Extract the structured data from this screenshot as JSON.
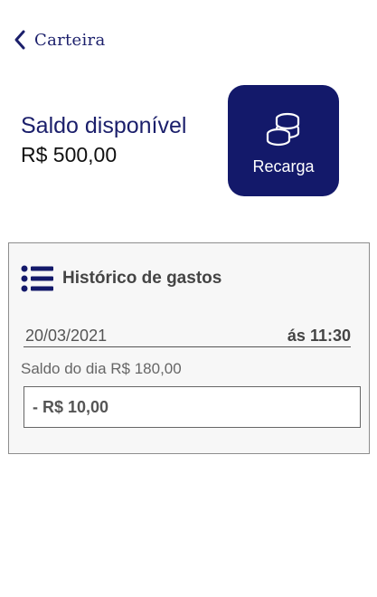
{
  "header": {
    "title": "Carteira",
    "back_icon": "chevron-left-icon"
  },
  "balance": {
    "label": "Saldo disponível",
    "value": "R$ 500,00"
  },
  "recharge": {
    "label": "Recarga",
    "icon": "coins-icon"
  },
  "history": {
    "title": "Histórico de gastos",
    "icon": "list-icon",
    "entries": [
      {
        "date": "20/03/2021",
        "time": "ás 11:30",
        "day_balance": "Saldo do dia R$ 180,00",
        "amount": "- R$ 10,00"
      }
    ]
  },
  "colors": {
    "primary": "#13196a",
    "text_dark": "#111111",
    "muted": "#555555",
    "panel_bg": "#f7f7f7"
  }
}
